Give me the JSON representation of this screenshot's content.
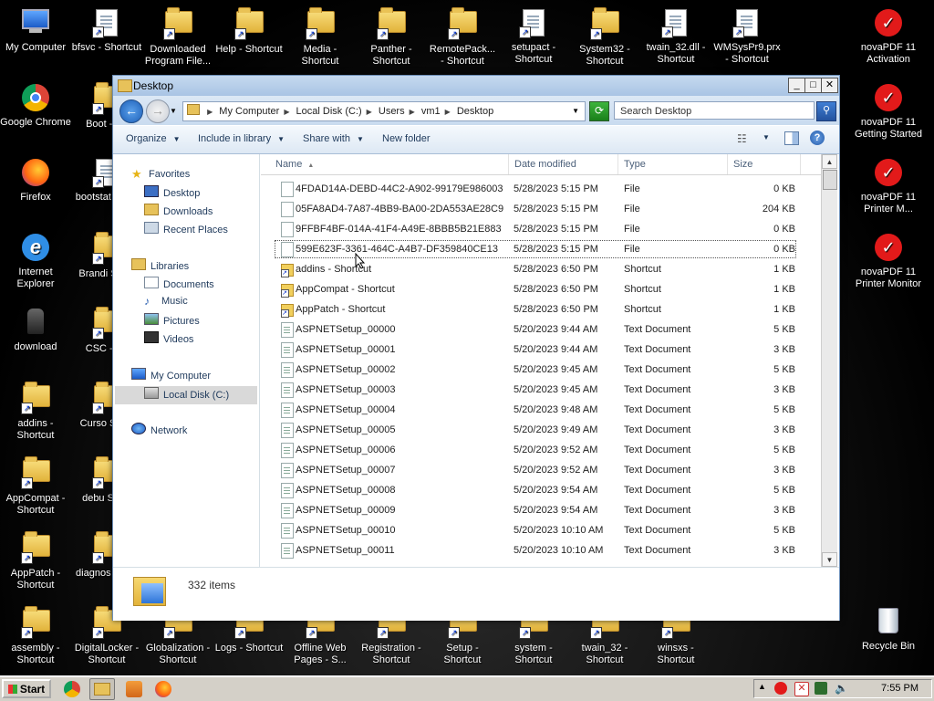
{
  "desktop": {
    "icons_top": [
      {
        "label": "My Computer"
      },
      {
        "label": "bfsvc - Shortcut"
      },
      {
        "label": "Downloaded Program File..."
      },
      {
        "label": "Help - Shortcut"
      },
      {
        "label": "Media - Shortcut"
      },
      {
        "label": "Panther - Shortcut"
      },
      {
        "label": "RemotePack... - Shortcut"
      },
      {
        "label": "setupact - Shortcut"
      },
      {
        "label": "System32 - Shortcut"
      },
      {
        "label": "twain_32.dll - Shortcut"
      },
      {
        "label": "WMSysPr9.prx - Shortcut"
      }
    ],
    "icons_left": [
      {
        "label": "Google Chrome"
      },
      {
        "label": "Firefox"
      },
      {
        "label": "Internet Explorer"
      },
      {
        "label": "download"
      },
      {
        "label": "addins - Shortcut"
      },
      {
        "label": "AppCompat - Shortcut"
      },
      {
        "label": "AppPatch - Shortcut"
      },
      {
        "label": "assembly - Shortcut"
      }
    ],
    "icons_col2": [
      {
        "label": "Boot - Sh"
      },
      {
        "label": "bootstat Short"
      },
      {
        "label": "Brandi Short"
      },
      {
        "label": "CSC - Sh"
      },
      {
        "label": "Curso Short"
      },
      {
        "label": "debu Short"
      },
      {
        "label": "diagnos Short"
      },
      {
        "label": "DigitalLocker - Shortcut"
      }
    ],
    "icons_bottom": [
      {
        "label": "Globalization - Shortcut"
      },
      {
        "label": "Logs - Shortcut"
      },
      {
        "label": "Offline Web Pages - S..."
      },
      {
        "label": "Registration - Shortcut"
      },
      {
        "label": "Setup - Shortcut"
      },
      {
        "label": "system - Shortcut"
      },
      {
        "label": "twain_32 - Shortcut"
      },
      {
        "label": "winsxs - Shortcut"
      }
    ],
    "icons_right": [
      {
        "label": "novaPDF 11 Activation"
      },
      {
        "label": "novaPDF 11 Getting Started"
      },
      {
        "label": "novaPDF 11 Printer M..."
      },
      {
        "label": "novaPDF 11 Printer Monitor"
      },
      {
        "label": "Recycle Bin"
      }
    ]
  },
  "window": {
    "title": "Desktop",
    "address": [
      "My Computer",
      "Local Disk (C:)",
      "Users",
      "vm1",
      "Desktop"
    ],
    "search_placeholder": "Search Desktop",
    "toolbar": {
      "organize": "Organize",
      "include": "Include in library",
      "share": "Share with",
      "newfolder": "New folder"
    },
    "nav": {
      "favorites": "Favorites",
      "desktop": "Desktop",
      "downloads": "Downloads",
      "recent": "Recent Places",
      "libraries": "Libraries",
      "documents": "Documents",
      "music": "Music",
      "pictures": "Pictures",
      "videos": "Videos",
      "mycomputer": "My Computer",
      "localdisk": "Local Disk (C:)",
      "network": "Network"
    },
    "columns": {
      "name": "Name",
      "date": "Date modified",
      "type": "Type",
      "size": "Size"
    },
    "files": [
      {
        "name": "4FDAD14A-DEBD-44C2-A902-99179E986003",
        "date": "5/28/2023 5:15 PM",
        "type": "File",
        "size": "0 KB",
        "kind": "file"
      },
      {
        "name": "05FA8AD4-7A87-4BB9-BA00-2DA553AE28C9",
        "date": "5/28/2023 5:15 PM",
        "type": "File",
        "size": "204 KB",
        "kind": "file"
      },
      {
        "name": "9FFBF4BF-014A-41F4-A49E-8BBB5B21E883",
        "date": "5/28/2023 5:15 PM",
        "type": "File",
        "size": "0 KB",
        "kind": "file"
      },
      {
        "name": "599E623F-3361-464C-A4B7-DF359840CE13",
        "date": "5/28/2023 5:15 PM",
        "type": "File",
        "size": "0 KB",
        "kind": "file"
      },
      {
        "name": "addins - Shortcut",
        "date": "5/28/2023 6:50 PM",
        "type": "Shortcut",
        "size": "1 KB",
        "kind": "sc"
      },
      {
        "name": "AppCompat - Shortcut",
        "date": "5/28/2023 6:50 PM",
        "type": "Shortcut",
        "size": "1 KB",
        "kind": "sc"
      },
      {
        "name": "AppPatch - Shortcut",
        "date": "5/28/2023 6:50 PM",
        "type": "Shortcut",
        "size": "1 KB",
        "kind": "sc"
      },
      {
        "name": "ASPNETSetup_00000",
        "date": "5/20/2023 9:44 AM",
        "type": "Text Document",
        "size": "5 KB",
        "kind": "txt"
      },
      {
        "name": "ASPNETSetup_00001",
        "date": "5/20/2023 9:44 AM",
        "type": "Text Document",
        "size": "3 KB",
        "kind": "txt"
      },
      {
        "name": "ASPNETSetup_00002",
        "date": "5/20/2023 9:45 AM",
        "type": "Text Document",
        "size": "5 KB",
        "kind": "txt"
      },
      {
        "name": "ASPNETSetup_00003",
        "date": "5/20/2023 9:45 AM",
        "type": "Text Document",
        "size": "3 KB",
        "kind": "txt"
      },
      {
        "name": "ASPNETSetup_00004",
        "date": "5/20/2023 9:48 AM",
        "type": "Text Document",
        "size": "5 KB",
        "kind": "txt"
      },
      {
        "name": "ASPNETSetup_00005",
        "date": "5/20/2023 9:49 AM",
        "type": "Text Document",
        "size": "3 KB",
        "kind": "txt"
      },
      {
        "name": "ASPNETSetup_00006",
        "date": "5/20/2023 9:52 AM",
        "type": "Text Document",
        "size": "5 KB",
        "kind": "txt"
      },
      {
        "name": "ASPNETSetup_00007",
        "date": "5/20/2023 9:52 AM",
        "type": "Text Document",
        "size": "3 KB",
        "kind": "txt"
      },
      {
        "name": "ASPNETSetup_00008",
        "date": "5/20/2023 9:54 AM",
        "type": "Text Document",
        "size": "5 KB",
        "kind": "txt"
      },
      {
        "name": "ASPNETSetup_00009",
        "date": "5/20/2023 9:54 AM",
        "type": "Text Document",
        "size": "3 KB",
        "kind": "txt"
      },
      {
        "name": "ASPNETSetup_00010",
        "date": "5/20/2023 10:10 AM",
        "type": "Text Document",
        "size": "5 KB",
        "kind": "txt"
      },
      {
        "name": "ASPNETSetup_00011",
        "date": "5/20/2023 10:10 AM",
        "type": "Text Document",
        "size": "3 KB",
        "kind": "txt"
      }
    ],
    "status": "332 items"
  },
  "taskbar": {
    "start": "Start",
    "clock": "7:55 PM"
  },
  "colors": {
    "title_bar": "#a9c4e4",
    "window_frame": "#bcd0e6",
    "nav_text": "#1e395b",
    "taskbar": "#d4d0c8",
    "novapdf_red": "#e21a1a"
  }
}
